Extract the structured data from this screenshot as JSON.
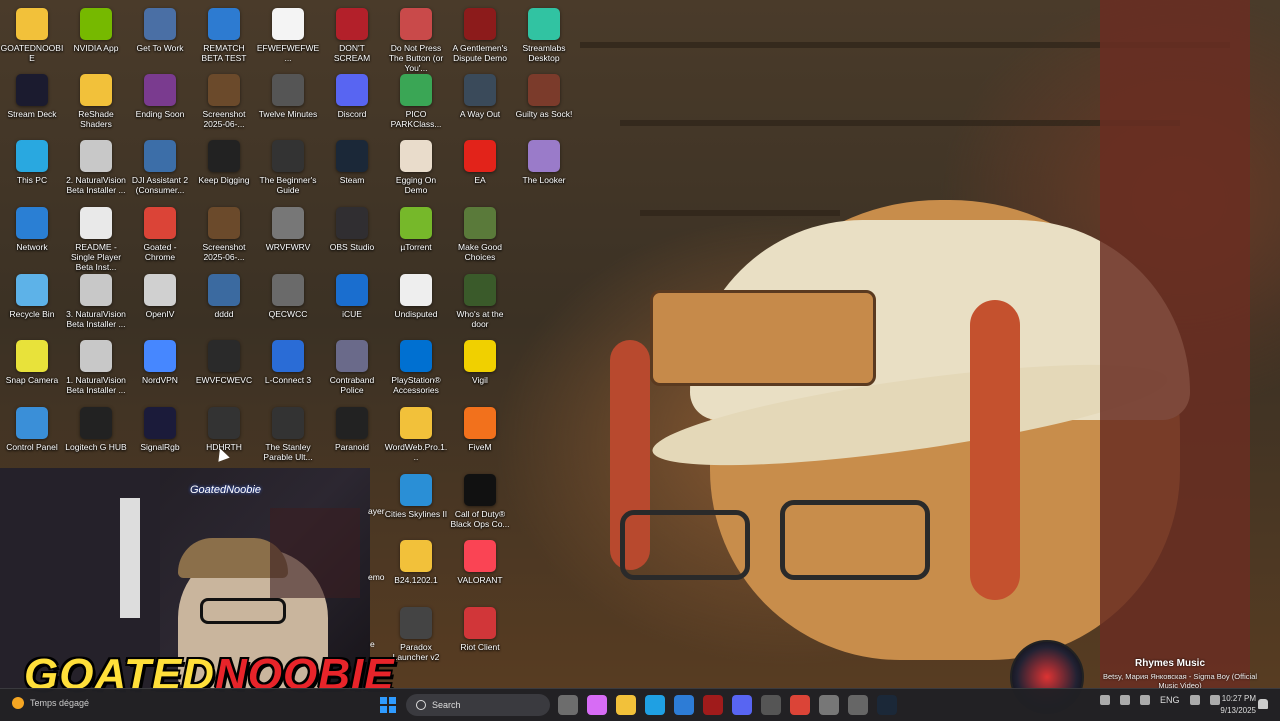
{
  "desktop": {
    "icons": [
      {
        "label": "GOATEDNOOBIE",
        "icon": "folder-icon",
        "color": "#f2c13a"
      },
      {
        "label": "NVIDIA App",
        "icon": "nvidia-icon",
        "color": "#76b900"
      },
      {
        "label": "Get To Work",
        "icon": "game-icon",
        "color": "#4a6fa5"
      },
      {
        "label": "REMATCH BETA TEST",
        "icon": "game-icon",
        "color": "#2d7bd1"
      },
      {
        "label": "EFWEFWEFWE...",
        "icon": "shortcut-icon",
        "color": "#f4f4f4"
      },
      {
        "label": "DON'T SCREAM",
        "icon": "game-icon",
        "color": "#b3202a"
      },
      {
        "label": "Do Not Press The Button (or You'...",
        "icon": "game-icon",
        "color": "#c94a4a"
      },
      {
        "label": "A Gentlemen's Dispute Demo",
        "icon": "game-icon",
        "color": "#8c1b1b"
      },
      {
        "label": "Streamlabs Desktop",
        "icon": "streamlabs-icon",
        "color": "#31c3a2"
      },
      {
        "label": "Stream Deck",
        "icon": "streamdeck-icon",
        "color": "#1b1b2f"
      },
      {
        "label": "ReShade Shaders",
        "icon": "folder-icon",
        "color": "#f2c13a"
      },
      {
        "label": "Ending Soon",
        "icon": "image-icon",
        "color": "#7a3b8f"
      },
      {
        "label": "Screenshot 2025-06-...",
        "icon": "image-icon",
        "color": "#6b4a2b"
      },
      {
        "label": "Twelve Minutes",
        "icon": "game-icon",
        "color": "#555555"
      },
      {
        "label": "Discord",
        "icon": "discord-icon",
        "color": "#5865f2"
      },
      {
        "label": "PICO PARKClass...",
        "icon": "game-icon",
        "color": "#3aa655"
      },
      {
        "label": "A Way Out",
        "icon": "game-icon",
        "color": "#3a4a5a"
      },
      {
        "label": "Guilty as Sock!",
        "icon": "game-icon",
        "color": "#7b3b2b"
      },
      {
        "label": "This PC",
        "icon": "monitor-icon",
        "color": "#29a8e0"
      },
      {
        "label": "2. NaturalVision Beta Installer ...",
        "icon": "installer-icon",
        "color": "#c8c8c8"
      },
      {
        "label": "DJI Assistant 2 (Consumer...",
        "icon": "dji-icon",
        "color": "#3c6ea8"
      },
      {
        "label": "Keep Digging",
        "icon": "pickaxe-icon",
        "color": "#222222"
      },
      {
        "label": "The Beginner's Guide",
        "icon": "game-icon",
        "color": "#333333"
      },
      {
        "label": "Steam",
        "icon": "steam-icon",
        "color": "#1b2838"
      },
      {
        "label": "Egging On Demo",
        "icon": "egg-icon",
        "color": "#e9dccb"
      },
      {
        "label": "EA",
        "icon": "ea-icon",
        "color": "#e2231a"
      },
      {
        "label": "The Looker",
        "icon": "game-icon",
        "color": "#9a7bc9"
      },
      {
        "label": "Network",
        "icon": "network-icon",
        "color": "#2a7fd4"
      },
      {
        "label": "README - Single Player Beta Inst...",
        "icon": "chrome-doc-icon",
        "color": "#e9e9e9"
      },
      {
        "label": "Goated - Chrome",
        "icon": "chrome-icon",
        "color": "#db4437"
      },
      {
        "label": "Screenshot 2025-06-...",
        "icon": "image-icon",
        "color": "#6b4a2b"
      },
      {
        "label": "WRVFWRV",
        "icon": "shortcut-icon",
        "color": "#777777"
      },
      {
        "label": "OBS Studio",
        "icon": "obs-icon",
        "color": "#302e31"
      },
      {
        "label": "µTorrent",
        "icon": "utorrent-icon",
        "color": "#76b82a"
      },
      {
        "label": "Make Good Choices",
        "icon": "game-icon",
        "color": "#5a7a3a"
      },
      {
        "label": "Recycle Bin",
        "icon": "recycle-bin-icon",
        "color": "#5db2e8"
      },
      {
        "label": "3. NaturalVision Beta Installer ...",
        "icon": "installer-icon",
        "color": "#c8c8c8"
      },
      {
        "label": "OpenIV",
        "icon": "openiv-icon",
        "color": "#d0d0d0"
      },
      {
        "label": "dddd",
        "icon": "image-icon",
        "color": "#3b6aa0"
      },
      {
        "label": "QECWCC",
        "icon": "shortcut-icon",
        "color": "#6a6a6a"
      },
      {
        "label": "iCUE",
        "icon": "icue-icon",
        "color": "#1a6ecf"
      },
      {
        "label": "Undisputed",
        "icon": "game-icon",
        "color": "#eeeeee"
      },
      {
        "label": "Who's at the door",
        "icon": "game-icon",
        "color": "#3a5a2a"
      },
      {
        "label": "Snap Camera",
        "icon": "snap-camera-icon",
        "color": "#e8e23a"
      },
      {
        "label": "1. NaturalVision Beta Installer ...",
        "icon": "installer-icon",
        "color": "#c8c8c8"
      },
      {
        "label": "NordVPN",
        "icon": "nordvpn-icon",
        "color": "#4687ff"
      },
      {
        "label": "EWVFCWEVC",
        "icon": "shortcut-icon",
        "color": "#2a2a2a"
      },
      {
        "label": "L-Connect 3",
        "icon": "lconnect-icon",
        "color": "#2a6cd6"
      },
      {
        "label": "Contraband Police",
        "icon": "game-icon",
        "color": "#6a6a8a"
      },
      {
        "label": "PlayStation® Accessories",
        "icon": "playstation-icon",
        "color": "#0070d1"
      },
      {
        "label": "Vigil",
        "icon": "vigil-icon",
        "color": "#f0d000"
      },
      {
        "label": "Control Panel",
        "icon": "control-panel-icon",
        "color": "#3a8fd8"
      },
      {
        "label": "Logitech G HUB",
        "icon": "logitech-icon",
        "color": "#222222"
      },
      {
        "label": "SignalRgb",
        "icon": "signalrgb-icon",
        "color": "#1b1b3a"
      },
      {
        "label": "HDHRTH",
        "icon": "shortcut-icon",
        "color": "#333333"
      },
      {
        "label": "The Stanley Parable Ult...",
        "icon": "game-icon",
        "color": "#333333"
      },
      {
        "label": "Paranoid",
        "icon": "game-icon",
        "color": "#222222"
      },
      {
        "label": "WordWeb.Pro.1...",
        "icon": "folder-icon",
        "color": "#f2c13a"
      },
      {
        "label": "FiveM",
        "icon": "fivem-icon",
        "color": "#f2711c"
      },
      {
        "label": "Cities Skylines II",
        "icon": "game-icon",
        "color": "#2a8fd6"
      },
      {
        "label": "Call of Duty® Black Ops Co...",
        "icon": "game-icon",
        "color": "#111111"
      },
      {
        "label": "B24.1202.1",
        "icon": "folder-icon",
        "color": "#f2c13a"
      },
      {
        "label": "VALORANT",
        "icon": "valorant-icon",
        "color": "#fa4454"
      },
      {
        "label": "Paradox Launcher v2",
        "icon": "paradox-icon",
        "color": "#444444"
      },
      {
        "label": "Riot Client",
        "icon": "riot-icon",
        "color": "#d13639"
      }
    ],
    "partial_labels": [
      "ayer",
      "emo",
      "e"
    ]
  },
  "webcam": {
    "handle": "GoatedNoobie",
    "brand_part1": "GOATED",
    "brand_part2": "NOOBIE"
  },
  "now_playing": {
    "title": "Rhymes Music",
    "subtitle": "Betsy, Мария Янковская - Sigma Boy (Official Music Video)"
  },
  "taskbar": {
    "weather_text": "Temps dégagé",
    "search_placeholder": "Search",
    "apps": [
      {
        "name": "task-view-icon",
        "color": "#6d6d6d"
      },
      {
        "name": "copilot-icon",
        "color": "#d76cf5"
      },
      {
        "name": "file-explorer-icon",
        "color": "#f2c13a"
      },
      {
        "name": "edge-icon",
        "color": "#1fa0e3"
      },
      {
        "name": "store-icon",
        "color": "#2d7cd6"
      },
      {
        "name": "app-red-icon",
        "color": "#a01b1b"
      },
      {
        "name": "discord-taskbar-icon",
        "color": "#5865f2"
      },
      {
        "name": "app-dark-icon",
        "color": "#555555"
      },
      {
        "name": "chrome-taskbar-icon",
        "color": "#db4437"
      },
      {
        "name": "settings-icon",
        "color": "#777777"
      },
      {
        "name": "app-slate-icon",
        "color": "#666666"
      },
      {
        "name": "steam-taskbar-icon",
        "color": "#1b2838"
      }
    ],
    "language": "ENG",
    "time": "10:27 PM",
    "date": "9/13/2025"
  }
}
